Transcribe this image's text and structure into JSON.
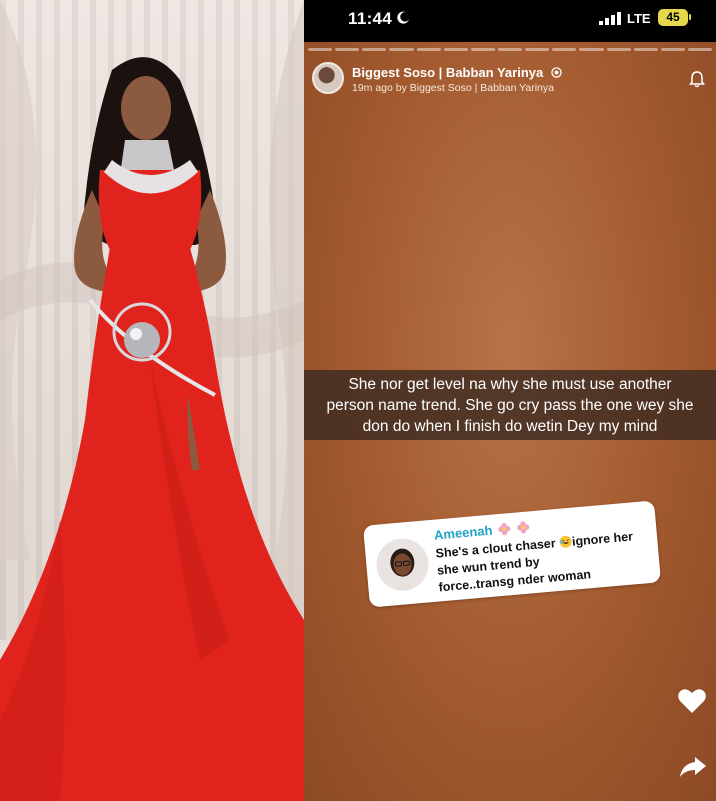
{
  "status_bar": {
    "time": "11:44",
    "network": "LTE",
    "battery": "45"
  },
  "story": {
    "account_name": "Biggest Soso | Babban Yarinya",
    "posted_meta": "19m ago by Biggest Soso | Babban Yarinya",
    "segments": 15,
    "caption_lines": [
      "She nor get level na why she must use another",
      "person name trend. She go cry pass the one wey she",
      "don do when I finish do wetin Dey my mind"
    ]
  },
  "comment": {
    "author": "Ameenah",
    "line1_before": "She's a clout chaser ",
    "line1_after": "ignore her",
    "line2": "she wun trend by",
    "line3": "force..transg",
    "line3_after": "nder woman"
  },
  "icons": {
    "moon": "moon-icon",
    "signal": "signal-icon",
    "verified": "verified-icon",
    "bell": "bell-icon",
    "heart": "heart-icon",
    "share": "share-icon",
    "flower": "flower-icon",
    "laugh": "laughing-emoji-icon"
  },
  "colors": {
    "story_bg": "#a2592e",
    "comment_name": "#1fa3c6",
    "battery": "#e6d84c",
    "dress": "#e0241d"
  }
}
